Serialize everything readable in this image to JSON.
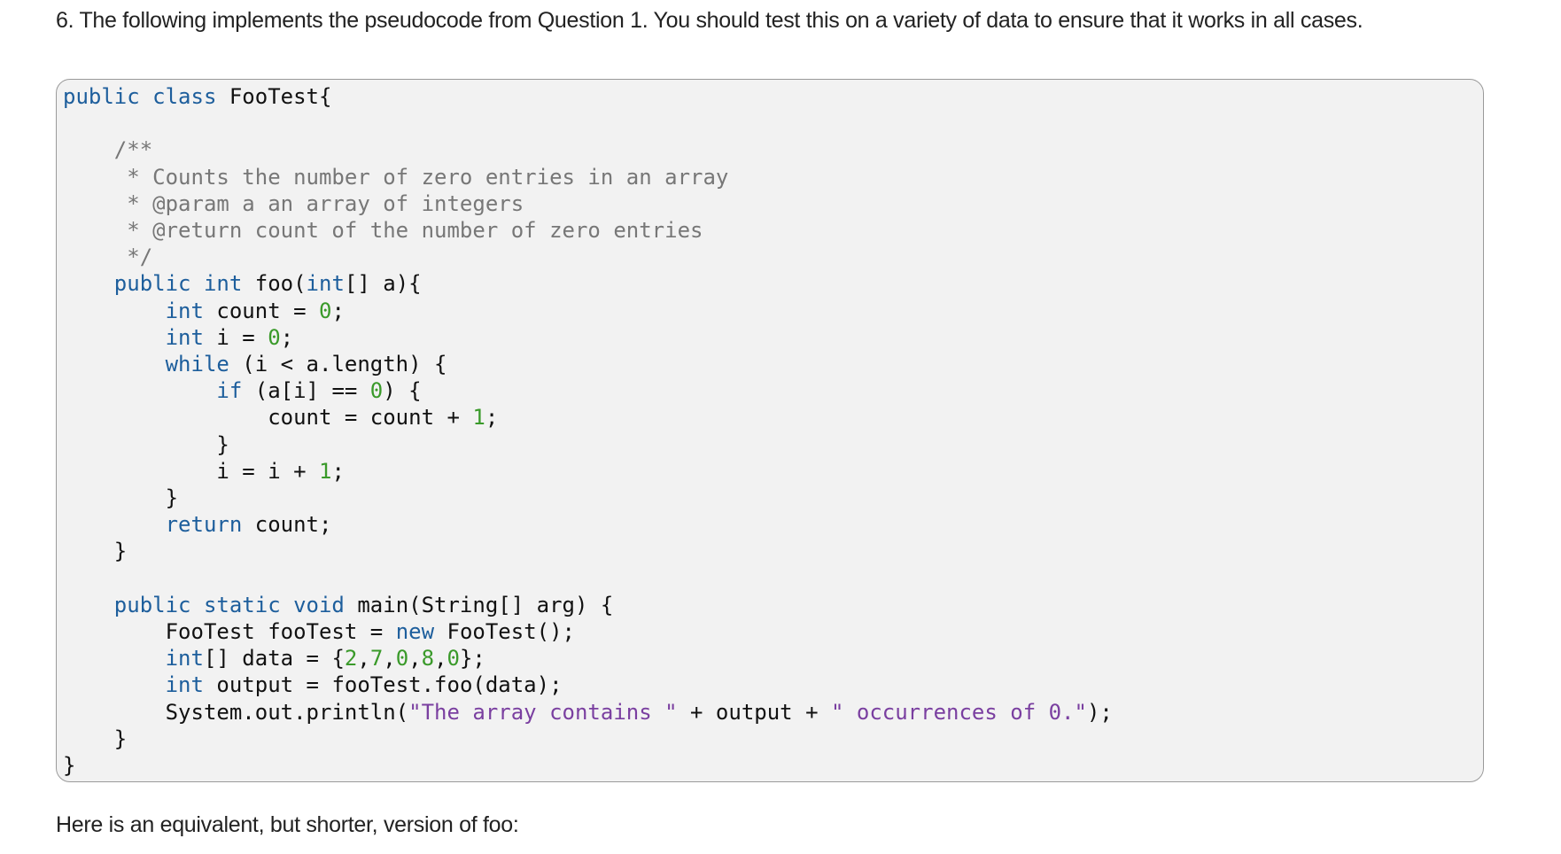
{
  "intro": "6. The following implements the pseudocode from Question 1. You should test this on a variety of data to ensure that it works in all cases.",
  "code_lines": [
    [
      {
        "t": "public class",
        "c": "kw"
      },
      {
        "t": " FooTest{",
        "c": ""
      }
    ],
    [],
    [
      {
        "t": "    /**",
        "c": "cm"
      }
    ],
    [
      {
        "t": "     * Counts the number of zero entries in an array",
        "c": "cm"
      }
    ],
    [
      {
        "t": "     * @param a an array of integers",
        "c": "cm"
      }
    ],
    [
      {
        "t": "     * @return count of the number of zero entries",
        "c": "cm"
      }
    ],
    [
      {
        "t": "     */",
        "c": "cm"
      }
    ],
    [
      {
        "t": "    public int",
        "c": "kw"
      },
      {
        "t": " foo(",
        "c": ""
      },
      {
        "t": "int",
        "c": "kw"
      },
      {
        "t": "[] a){",
        "c": ""
      }
    ],
    [
      {
        "t": "        int",
        "c": "kw"
      },
      {
        "t": " count = ",
        "c": ""
      },
      {
        "t": "0",
        "c": "num"
      },
      {
        "t": ";",
        "c": ""
      }
    ],
    [
      {
        "t": "        int",
        "c": "kw"
      },
      {
        "t": " i = ",
        "c": ""
      },
      {
        "t": "0",
        "c": "num"
      },
      {
        "t": ";",
        "c": ""
      }
    ],
    [
      {
        "t": "        while",
        "c": "kw"
      },
      {
        "t": " (i < a.length) {",
        "c": ""
      }
    ],
    [
      {
        "t": "            if",
        "c": "kw"
      },
      {
        "t": " (a[i] == ",
        "c": ""
      },
      {
        "t": "0",
        "c": "num"
      },
      {
        "t": ") {",
        "c": ""
      }
    ],
    [
      {
        "t": "                count = count + ",
        "c": ""
      },
      {
        "t": "1",
        "c": "num"
      },
      {
        "t": ";",
        "c": ""
      }
    ],
    [
      {
        "t": "            }",
        "c": ""
      }
    ],
    [
      {
        "t": "            i = i + ",
        "c": ""
      },
      {
        "t": "1",
        "c": "num"
      },
      {
        "t": ";",
        "c": ""
      }
    ],
    [
      {
        "t": "        }",
        "c": ""
      }
    ],
    [
      {
        "t": "        return",
        "c": "kw"
      },
      {
        "t": " count;",
        "c": ""
      }
    ],
    [
      {
        "t": "    }",
        "c": ""
      }
    ],
    [],
    [
      {
        "t": "    public static void",
        "c": "kw"
      },
      {
        "t": " main(String[] arg) {",
        "c": ""
      }
    ],
    [
      {
        "t": "        FooTest fooTest = ",
        "c": ""
      },
      {
        "t": "new",
        "c": "kw"
      },
      {
        "t": " FooTest();",
        "c": ""
      }
    ],
    [
      {
        "t": "        int",
        "c": "kw"
      },
      {
        "t": "[] data = {",
        "c": ""
      },
      {
        "t": "2",
        "c": "num"
      },
      {
        "t": ",",
        "c": ""
      },
      {
        "t": "7",
        "c": "num"
      },
      {
        "t": ",",
        "c": ""
      },
      {
        "t": "0",
        "c": "num"
      },
      {
        "t": ",",
        "c": ""
      },
      {
        "t": "8",
        "c": "num"
      },
      {
        "t": ",",
        "c": ""
      },
      {
        "t": "0",
        "c": "num"
      },
      {
        "t": "};",
        "c": ""
      }
    ],
    [
      {
        "t": "        int",
        "c": "kw"
      },
      {
        "t": " output = fooTest.foo(data);",
        "c": ""
      }
    ],
    [
      {
        "t": "        System.out.println(",
        "c": ""
      },
      {
        "t": "\"The array contains \"",
        "c": "str"
      },
      {
        "t": " + output + ",
        "c": ""
      },
      {
        "t": "\" occurrences of 0.\"",
        "c": "str"
      },
      {
        "t": ");",
        "c": ""
      }
    ],
    [
      {
        "t": "    }",
        "c": ""
      }
    ],
    [
      {
        "t": "}",
        "c": ""
      }
    ]
  ],
  "outro": "Here is an equivalent, but shorter, version of foo:"
}
